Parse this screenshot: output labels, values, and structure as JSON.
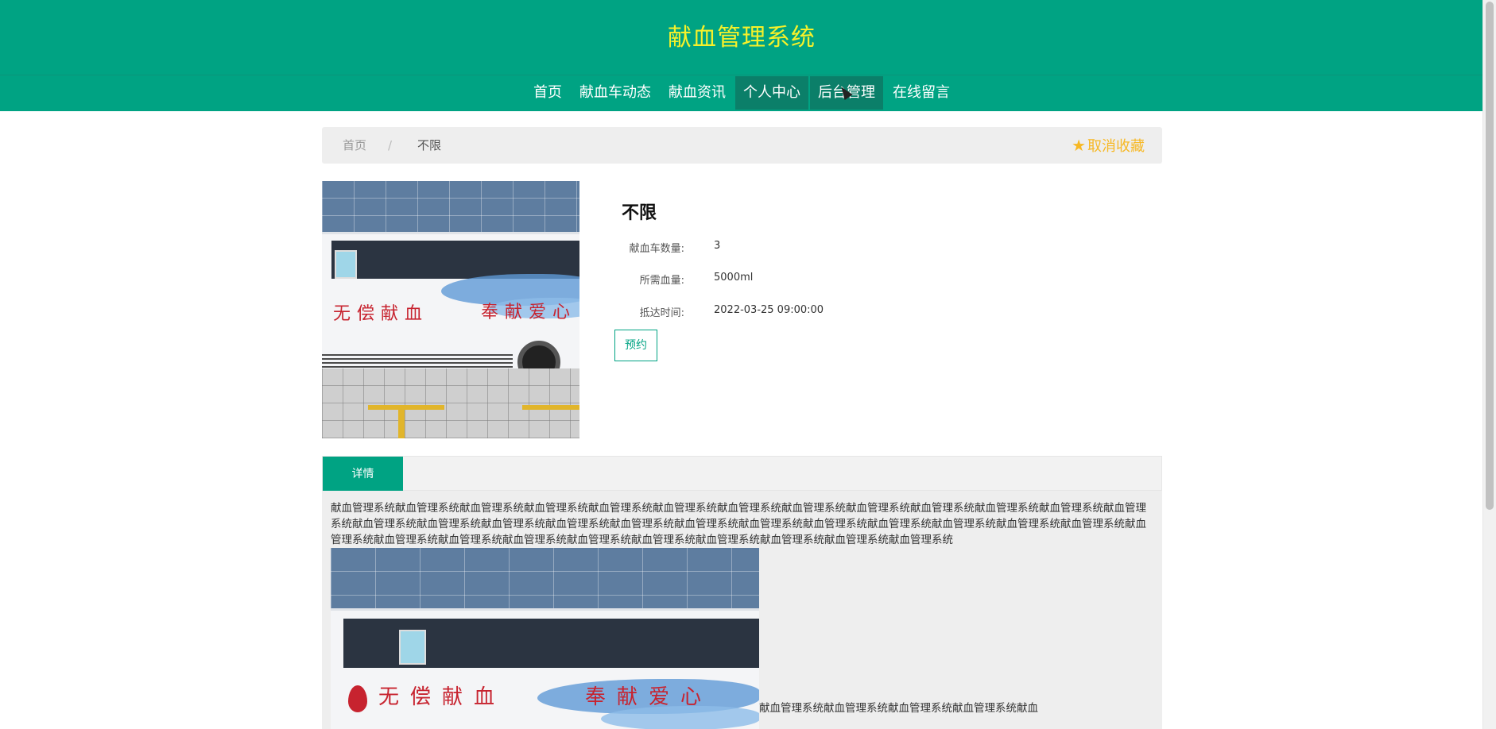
{
  "header": {
    "title": "献血管理系统"
  },
  "nav": {
    "items": [
      {
        "label": "首页"
      },
      {
        "label": "献血车动态"
      },
      {
        "label": "献血资讯"
      },
      {
        "label": "个人中心"
      },
      {
        "label": "后台管理"
      },
      {
        "label": "在线留言"
      }
    ],
    "active": [
      "个人中心",
      "后台管理"
    ]
  },
  "breadcrumb": {
    "home": "首页",
    "separator": "/",
    "current": "不限",
    "favorite_icon": "star-icon",
    "favorite_label": "取消收藏"
  },
  "product": {
    "name": "不限",
    "fields": [
      {
        "label": "献血车数量:",
        "value": "3"
      },
      {
        "label": "所需血量:",
        "value": "5000ml"
      },
      {
        "label": "抵达时间:",
        "value": "2022-03-25 09:00:00"
      }
    ],
    "book_label": "预约",
    "image_text": [
      "无偿献血",
      "奉献爱心"
    ]
  },
  "tabs": {
    "items": [
      {
        "label": "详情"
      }
    ]
  },
  "detail": {
    "paragraph": "献血管理系统献血管理系统献血管理系统献血管理系统献血管理系统献血管理系统献血管理系统献血管理系统献血管理系统献血管理系统献血管理系统献血管理系统献血管理系统献血管理系统献血管理系统献血管理系统献血管理系统献血管理系统献血管理系统献血管理系统献血管理系统献血管理系统献血管理系统献血管理系统献血管理系统献血管理系统献血管理系统献血管理系统献血管理系统献血管理系统献血管理系统献血管理系统献血管理系统献血管理系统献血管理系统",
    "image_text": [
      "无偿献血",
      "奉献爱心"
    ],
    "tail_text": "献血管理系统献血管理系统献血管理系统献血管理系统献血"
  },
  "colors": {
    "brand": "#00a383",
    "title": "#f6f12a",
    "favorite": "#f7b824",
    "nav_active": "#0b7f69"
  }
}
